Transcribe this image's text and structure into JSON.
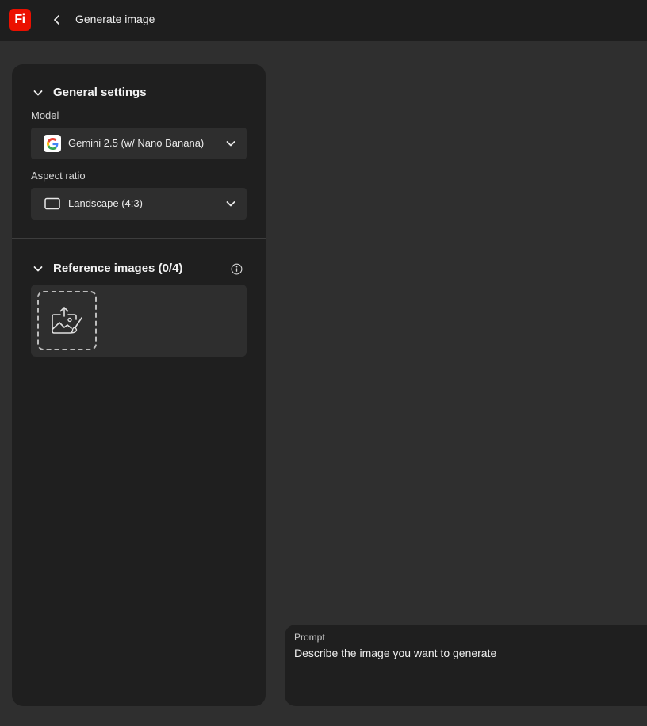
{
  "app": {
    "logo_text": "Fi",
    "brand_color": "#eb1000"
  },
  "header": {
    "title": "Generate image",
    "back_icon": "chevron-left-icon"
  },
  "general_settings": {
    "title": "General settings",
    "model": {
      "label": "Model",
      "value": "Gemini 2.5 (w/ Nano Banana)",
      "icon": "google-g-icon"
    },
    "aspect_ratio": {
      "label": "Aspect ratio",
      "value": "Landscape (4:3)",
      "icon": "landscape-frame-icon"
    }
  },
  "reference_images": {
    "title": "Reference images (0/4)",
    "info_icon": "info-icon",
    "upload_icon": "image-upload-icon"
  },
  "prompt": {
    "label": "Prompt",
    "placeholder": "Describe the image you want to generate"
  },
  "colors": {
    "background": "#2f2f2f",
    "panel": "#1f1f1f",
    "control": "#2e2e2e",
    "topbar": "#1e1e1e"
  }
}
